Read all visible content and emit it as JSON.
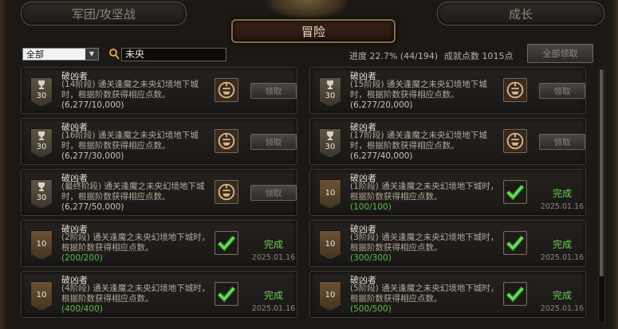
{
  "tabs": {
    "left": "军团/攻坚战",
    "right": "成长",
    "main": "冒险"
  },
  "filter": {
    "selected": "全部",
    "search_value": "未央"
  },
  "progress": "进度 22.7% (44/194)",
  "points": "成就点数 1015点",
  "claim_all": "全部领取",
  "claim_label": "领取",
  "done_label": "完成",
  "cards": [
    {
      "title": "破凶者",
      "desc": "(14阶段) 通关逢魔之未央幻境地下城时，根据阶数获得相应点数。",
      "progress": "(6,277/10,000)",
      "points": "30",
      "done": false,
      "date": ""
    },
    {
      "title": "破凶者",
      "desc": "(15阶段) 通关逢魔之未央幻境地下城时，根据阶数获得相应点数。",
      "progress": "(6,277/20,000)",
      "points": "30",
      "done": false,
      "date": ""
    },
    {
      "title": "破凶者",
      "desc": "(16阶段) 通关逢魔之未央幻境地下城时，根据阶数获得相应点数。",
      "progress": "(6,277/30,000)",
      "points": "30",
      "done": false,
      "date": ""
    },
    {
      "title": "破凶者",
      "desc": "(17阶段) 通关逢魔之未央幻境地下城时，根据阶数获得相应点数。",
      "progress": "(6,277/40,000)",
      "points": "30",
      "done": false,
      "date": ""
    },
    {
      "title": "破凶者",
      "desc": "(最终阶段) 通关逢魔之未央幻境地下城时，根据阶数获得相应点数。",
      "progress": "(6,277/50,000)",
      "points": "30",
      "done": false,
      "date": ""
    },
    {
      "title": "破凶者",
      "desc": "(1阶段) 通关逢魔之未央幻境地下城时，根据阶数获得相应点数。",
      "progress": "(100/100)",
      "points": "10",
      "done": true,
      "date": "2025.01.16"
    },
    {
      "title": "破凶者",
      "desc": "(2阶段) 通关逢魔之未央幻境地下城时，根据阶数获得相应点数。",
      "progress": "(200/200)",
      "points": "10",
      "done": true,
      "date": "2025.01.16"
    },
    {
      "title": "破凶者",
      "desc": "(3阶段) 通关逢魔之未央幻境地下城时，根据阶数获得相应点数。",
      "progress": "(300/300)",
      "points": "10",
      "done": true,
      "date": "2025.01.16"
    },
    {
      "title": "破凶者",
      "desc": "(4阶段) 通关逢魔之未央幻境地下城时，根据阶数获得相应点数。",
      "progress": "(400/400)",
      "points": "10",
      "done": true,
      "date": "2025.01.16"
    },
    {
      "title": "破凶者",
      "desc": "(5阶段) 通关逢魔之未央幻境地下城时，根据阶数获得相应点数。",
      "progress": "(500/500)",
      "points": "10",
      "done": true,
      "date": "2025.01.16"
    }
  ]
}
